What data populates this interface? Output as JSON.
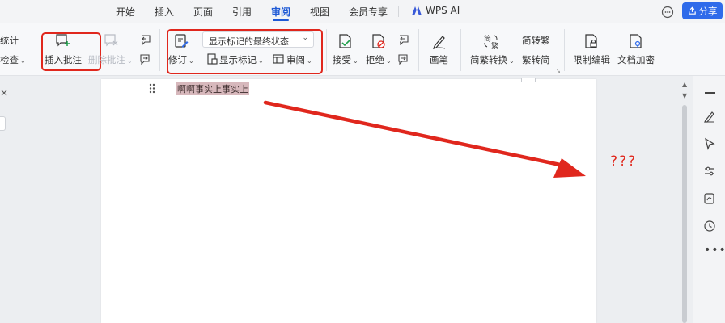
{
  "menu": {
    "tabs": [
      "开始",
      "插入",
      "页面",
      "引用",
      "审阅",
      "视图",
      "会员专享"
    ],
    "active_tab": "审阅",
    "wps_ai": "WPS AI",
    "share": "分享"
  },
  "ribbon": {
    "left_clipped": {
      "stats": "统计",
      "check": "检查"
    },
    "insert_comment": "插入批注",
    "delete_comment": "删除批注",
    "track_changes": "修订",
    "display_mode": "显示标记的最终状态",
    "show_markup": "显示标记",
    "review_pane": "审阅",
    "accept": "接受",
    "reject": "拒绝",
    "ink": "画笔",
    "convert": "简繁转换",
    "to_traditional": "简转繁",
    "to_simplified": "繁转简",
    "restrict_edit": "限制编辑",
    "encrypt": "文档加密"
  },
  "document": {
    "text": "啊啊事实上事实上"
  },
  "annotation": {
    "question_marks": "???"
  },
  "colors": {
    "accent": "#1f5ad6",
    "annotation_red": "#e0271d",
    "highlight": "#d7b8bc"
  }
}
